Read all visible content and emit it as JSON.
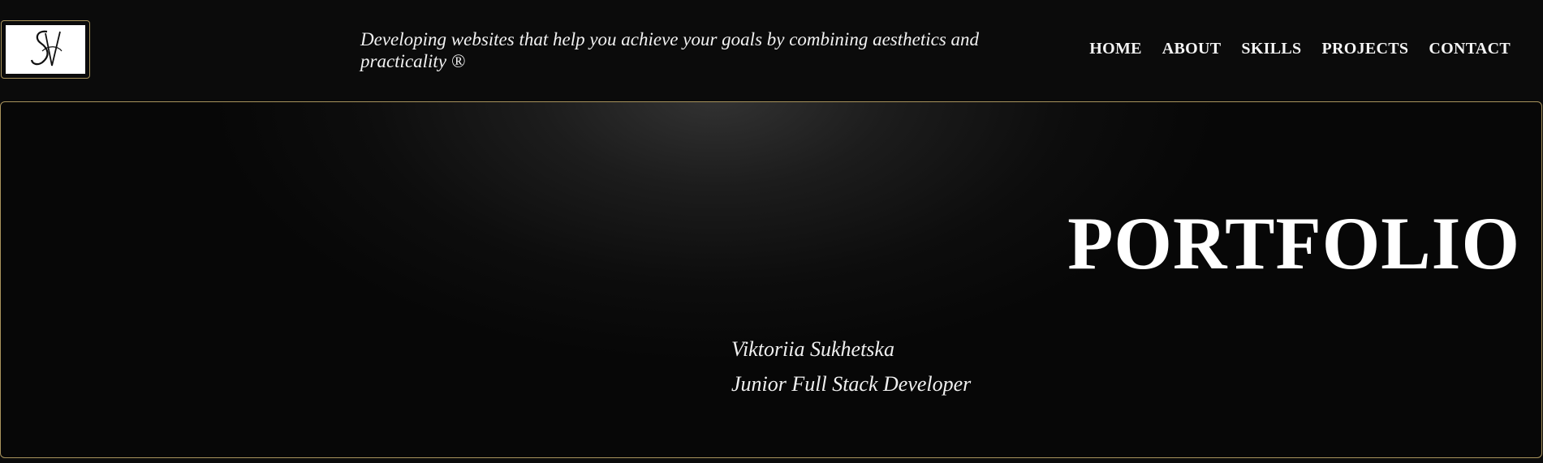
{
  "header": {
    "logo_alt": "SV",
    "tagline": "Developing websites that help you achieve your goals by combining aesthetics and practicality ®",
    "nav": [
      {
        "label": "HOME"
      },
      {
        "label": "ABOUT"
      },
      {
        "label": "SKILLS"
      },
      {
        "label": "PROJECTS"
      },
      {
        "label": "CONTACT"
      }
    ]
  },
  "hero": {
    "title": "PORTFOLIO",
    "name": "Viktoriia Sukhetska",
    "role": "Junior Full Stack Developer"
  },
  "colors": {
    "background": "#0b0b0b",
    "accent_border": "#a8935c",
    "text": "#ffffff"
  }
}
